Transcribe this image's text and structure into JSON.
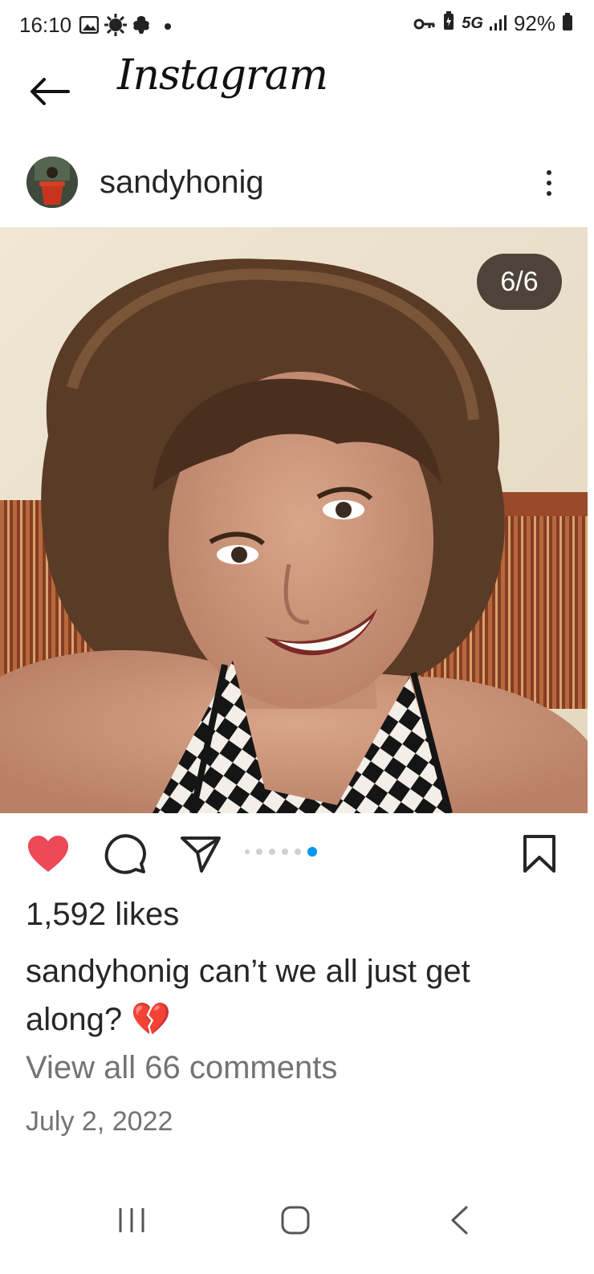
{
  "status_bar": {
    "time": "16:10",
    "network": "5G",
    "battery": "92%"
  },
  "header": {
    "app_name": "Instagram"
  },
  "post": {
    "username": "sandyhonig",
    "page_counter": "6/6",
    "carousel": {
      "total": 6,
      "current": 6
    },
    "liked": true,
    "likes": "1,592 likes",
    "caption_user": "sandyhonig",
    "caption_text": "can’t we all just get along? 💔",
    "view_comments": "View all 66 comments",
    "date": "July 2, 2022"
  },
  "colors": {
    "like_red": "#ed4956",
    "active_dot": "#0095f6",
    "muted_text": "#737373"
  },
  "icons": {
    "back": "arrow-left-icon",
    "more": "more-vertical-icon",
    "like": "heart-icon",
    "comment": "comment-icon",
    "share": "send-icon",
    "save": "bookmark-icon"
  }
}
